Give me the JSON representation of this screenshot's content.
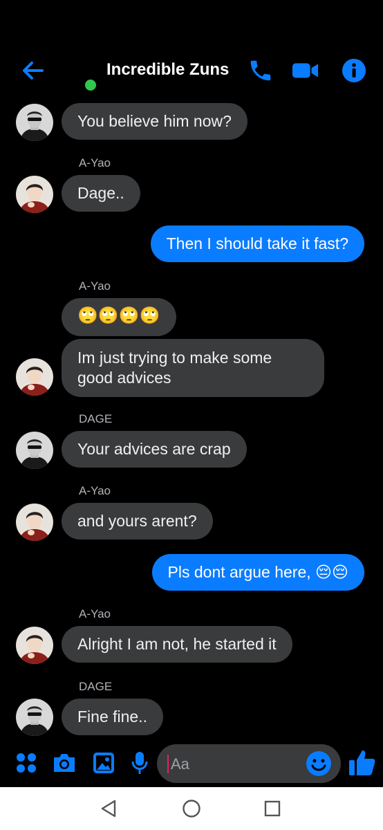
{
  "header": {
    "title": "Incredible Zuns",
    "back_icon": "back-arrow-icon",
    "call_icon": "phone-icon",
    "video_icon": "video-camera-icon",
    "info_icon": "info-icon",
    "online_color": "#31c64d",
    "accent_color": "#0a7cff"
  },
  "messages": [
    {
      "direction": "in",
      "sender": "",
      "avatar": "dage",
      "text": "You believe him now?"
    },
    {
      "direction": "in",
      "sender": "A-Yao",
      "avatar": "ayao",
      "text": "Dage.."
    },
    {
      "direction": "out",
      "text": "Then I should take it fast?"
    },
    {
      "direction": "in",
      "sender": "A-Yao",
      "avatar": "",
      "text": "🙄🙄🙄🙄"
    },
    {
      "direction": "in",
      "sender": "",
      "avatar": "ayao",
      "text": "Im just trying to make some good advices"
    },
    {
      "direction": "in",
      "sender": "DAGE",
      "avatar": "dage",
      "text": "Your advices are crap"
    },
    {
      "direction": "in",
      "sender": "A-Yao",
      "avatar": "ayao",
      "text": "and yours arent?"
    },
    {
      "direction": "out",
      "text": "Pls dont argue here, 😔😔"
    },
    {
      "direction": "in",
      "sender": "A-Yao",
      "avatar": "ayao",
      "text": "Alright I am not, he started it"
    },
    {
      "direction": "in",
      "sender": "DAGE",
      "avatar": "dage",
      "text": "Fine fine.."
    }
  ],
  "composer": {
    "placeholder": "Aa",
    "value": "",
    "icons": [
      "apps-grid-icon",
      "camera-icon",
      "gallery-icon",
      "microphone-icon",
      "emoji-icon",
      "thumbs-up-icon"
    ]
  },
  "navbar": {
    "icons": [
      "nav-back-icon",
      "nav-home-icon",
      "nav-recents-icon"
    ]
  }
}
